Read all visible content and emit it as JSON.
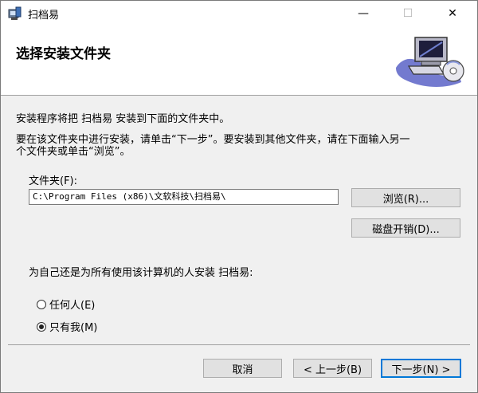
{
  "window": {
    "title": "扫档易",
    "minimize_glyph": "—",
    "maximize_glyph": "☐",
    "close_glyph": "✕"
  },
  "header": {
    "title": "选择安装文件夹",
    "banner_icon": "computer-disc-icon"
  },
  "body": {
    "line1": "安装程序将把 扫档易 安装到下面的文件夹中。",
    "line2a": "要在该文件夹中进行安装，请单击“下一步”。要安装到其他文件夹，请在下面输入另一",
    "line2b": "个文件夹或单击“浏览”。"
  },
  "folder": {
    "label": "文件夹(F):",
    "value": "C:\\Program Files (x86)\\文软科技\\扫档易\\",
    "browse_label": "浏览(R)...",
    "disk_cost_label": "磁盘开销(D)..."
  },
  "install_for": {
    "prompt": "为自己还是为所有使用该计算机的人安装 扫档易:",
    "options": [
      {
        "label": "任何人(E)",
        "checked": false
      },
      {
        "label": "只有我(M)",
        "checked": true
      }
    ]
  },
  "footer": {
    "cancel_label": "取消",
    "back_label": "< 上一步(B)",
    "next_label": "下一步(N) >"
  },
  "colors": {
    "accent": "#0078d7",
    "button_face": "#e1e1e1",
    "dialog_background": "#f0f0f0"
  }
}
